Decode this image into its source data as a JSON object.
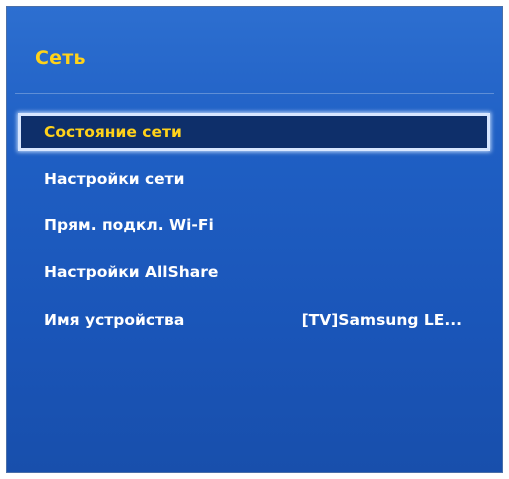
{
  "panel": {
    "title": "Сеть"
  },
  "menu": {
    "items": [
      {
        "label": "Состояние сети",
        "value": ""
      },
      {
        "label": "Настройки сети",
        "value": ""
      },
      {
        "label": "Прям. подкл. Wi-Fi",
        "value": ""
      },
      {
        "label": "Настройки AllShare",
        "value": ""
      },
      {
        "label": "Имя устройства",
        "value": "[TV]Samsung LE..."
      }
    ],
    "selected_index": 0
  },
  "colors": {
    "background": "#1f5fc4",
    "title": "#ffd21a",
    "selected_text": "#ffd21a",
    "selected_bg": "#0e2f6a",
    "text": "#ffffff"
  }
}
